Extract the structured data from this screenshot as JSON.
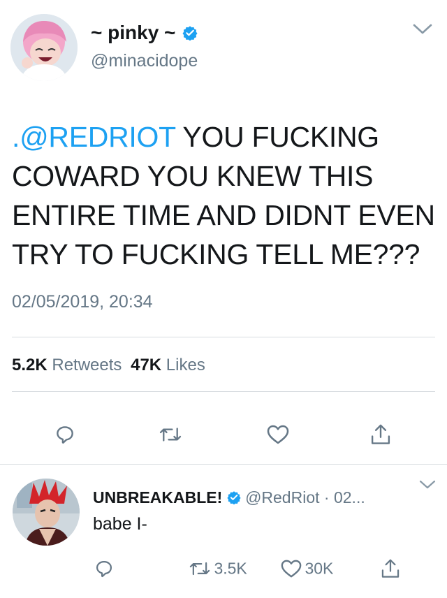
{
  "tweet": {
    "display_name": "~ pinky ~",
    "handle": "@minacidope",
    "mention": ".@REDRIOT",
    "text": " YOU FUCKING COWARD YOU KNEW THIS ENTIRE TIME AND DIDNT EVEN TRY TO FUCKING TELL ME???",
    "timestamp": "02/05/2019, 20:34",
    "retweets_count": "5.2K",
    "retweets_label": "Retweets",
    "likes_count": "47K",
    "likes_label": "Likes",
    "icons": [
      "reply-icon",
      "retweet-icon",
      "like-icon",
      "share-icon",
      "chevron-down-icon",
      "verified-icon"
    ]
  },
  "reply": {
    "display_name": "UNBREAKABLE!",
    "handle": "@RedRiot",
    "separator": "·",
    "date": "02...",
    "text": "babe I-",
    "retweets_count": "3.5K",
    "likes_count": "30K"
  },
  "colors": {
    "accent": "#1da1f2",
    "text": "#14171a",
    "secondary": "#657786",
    "divider": "#d6dbdf"
  }
}
